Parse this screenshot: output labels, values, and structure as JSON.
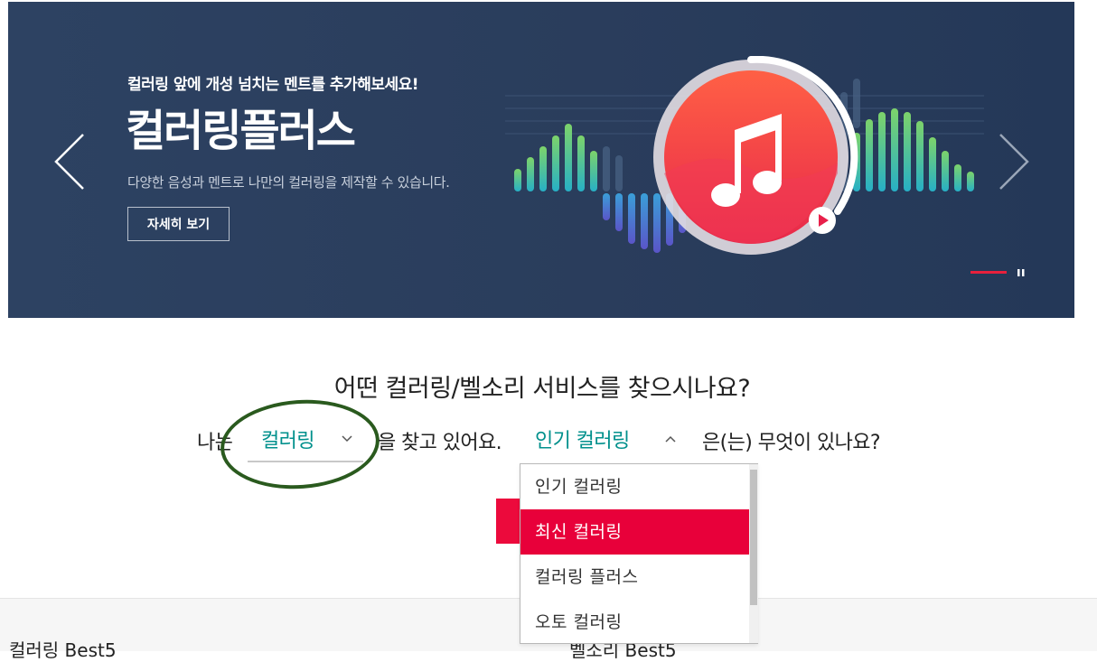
{
  "banner": {
    "subtitle": "컬러링 앞에 개성 넘치는 멘트를 추가해보세요!",
    "title": "컬러링플러스",
    "description": "다양한 음성과 멘트로 나만의 컬러링을 제작할 수 있습니다.",
    "detail_button": "자세히 보기",
    "prev_icon": "chevron-left-icon",
    "next_icon": "chevron-right-icon",
    "art_icon": "music-note-icon",
    "play_icon": "play-icon",
    "pause_icon": "pause-icon",
    "accent_color": "#e8203c"
  },
  "finder": {
    "question": "어떤 컬러링/벨소리 서비스를 찾으시나요?",
    "prefix": "나는",
    "type_value": "컬러링",
    "middle": "을 찾고 있어요.",
    "sort_value": "인기 컬러링",
    "suffix": "은(는) 무엇이 있나요?",
    "accent_color": "#00908c",
    "dropdown": {
      "options": [
        "인기 컬러링",
        "최신 컬러링",
        "컬러링 플러스",
        "오토 컬러링"
      ],
      "highlighted": "최신 컬러링",
      "highlight_color": "#e8003a"
    }
  },
  "footer": {
    "left_heading": "컬러링 Best5",
    "right_heading": "벨소리 Best5"
  }
}
